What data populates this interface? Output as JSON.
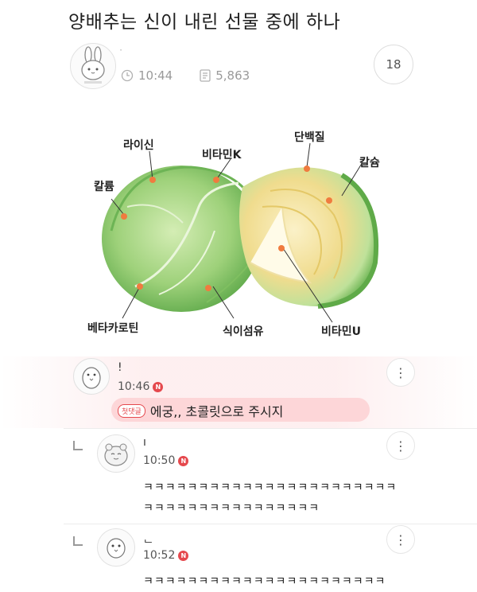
{
  "post": {
    "title": "양배추는 신이 내린 선물 중에 하나",
    "author": "ᐧ",
    "time": "10:44",
    "views": "5,863",
    "comment_count": "18"
  },
  "figure": {
    "labels": {
      "lysine": "라이신",
      "vitamin_k": "비타민K",
      "protein": "단백질",
      "calcium_right": "칼슘",
      "potassium": "칼륨",
      "beta_carotene": "베타카로틴",
      "fiber": "식이섬유",
      "vitamin_u": "비타민U"
    },
    "colors": {
      "dot": "#f07b3f",
      "cabbage_green": "#8ec96a",
      "core_yellow": "#f3dc8a"
    }
  },
  "comments": [
    {
      "author": "!",
      "time": "10:46",
      "badge": "첫댓글",
      "text": "에궁,, 초콜릿으로 주시지",
      "new": "N"
    },
    {
      "author": "ı",
      "time": "10:50",
      "text_line1": "ㅋㅋㅋㅋㅋㅋㅋㅋㅋㅋㅋㅋㅋㅋㅋㅋㅋㅋㅋㅋㅋㅋㅋ",
      "text_line2": "ㅋㅋㅋㅋㅋㅋㅋㅋㅋㅋㅋㅋㅋㅋㅋㅋ",
      "new": "N"
    },
    {
      "author": "ᆫ",
      "time": "10:52",
      "text_line1": "ㅋㅋㅋㅋㅋㅋㅋㅋㅋㅋㅋㅋㅋㅋㅋㅋㅋㅋㅋㅋㅋㅋ",
      "new": "N"
    }
  ],
  "icons": {
    "clock": "clock-icon",
    "doc": "views-icon",
    "more": "⋮",
    "reply": "reply-arrow-icon"
  }
}
